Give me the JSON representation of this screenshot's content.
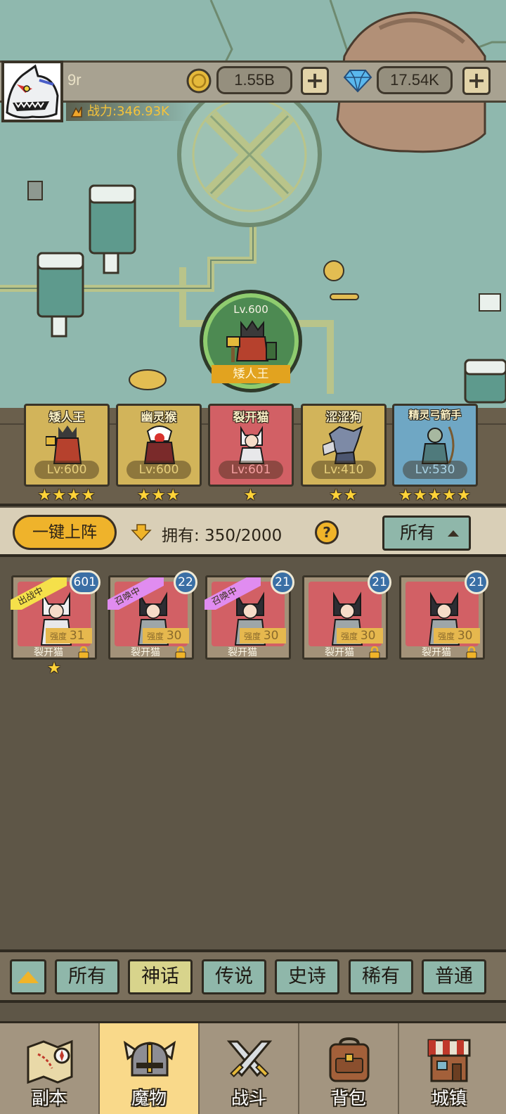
{
  "player": {
    "name": "9r",
    "power": "战力:346.93K"
  },
  "resources": {
    "gold": "1.55B",
    "gems": "17.54K",
    "plus": "+"
  },
  "featured": {
    "level": "Lv.600",
    "name": "矮人王"
  },
  "lineup": [
    {
      "name": "矮人王",
      "level": "Lv:600",
      "stars": "★★★★",
      "color": "#d2b45a"
    },
    {
      "name": "幽灵猴",
      "level": "Lv:600",
      "stars": "★★★",
      "color": "#d2b45a"
    },
    {
      "name": "裂开猫",
      "level": "Lv:601",
      "stars": "★",
      "color": "#d26065"
    },
    {
      "name": "涩涩狗",
      "level": "Lv:410",
      "stars": "★★",
      "color": "#d2b45a"
    },
    {
      "name": "精灵弓箭手",
      "level": "Lv:530",
      "stars": "★★★★★",
      "color": "#6fa7c4"
    }
  ],
  "controls": {
    "deploy": "一键上阵",
    "owned": "拥有: 350/2000",
    "help": "?",
    "filter": "所有"
  },
  "cards": [
    {
      "level": "601",
      "name": "裂开猫",
      "strength_label": "强度",
      "strength": "31",
      "ribbon": "出战中",
      "ribbon_color": "#f5e04a",
      "star": "★"
    },
    {
      "level": "22",
      "name": "裂开猫",
      "strength_label": "强度",
      "strength": "30",
      "ribbon": "召唤中",
      "ribbon_color": "#e08cf0",
      "star": ""
    },
    {
      "level": "21",
      "name": "裂开猫",
      "strength_label": "强度",
      "strength": "30",
      "ribbon": "召唤中",
      "ribbon_color": "#e08cf0",
      "star": ""
    },
    {
      "level": "21",
      "name": "裂开猫",
      "strength_label": "强度",
      "strength": "30",
      "ribbon": "",
      "ribbon_color": "",
      "star": ""
    },
    {
      "level": "21",
      "name": "裂开猫",
      "strength_label": "强度",
      "strength": "30",
      "ribbon": "",
      "ribbon_color": "",
      "star": ""
    }
  ],
  "rarity_tabs": [
    "所有",
    "神话",
    "传说",
    "史诗",
    "稀有",
    "普通"
  ],
  "active_rarity": 1,
  "nav": [
    {
      "label": "副本",
      "icon": "map-icon"
    },
    {
      "label": "魔物",
      "icon": "helmet-icon"
    },
    {
      "label": "战斗",
      "icon": "crossed-swords-icon"
    },
    {
      "label": "背包",
      "icon": "backpack-icon"
    },
    {
      "label": "城镇",
      "icon": "house-icon"
    }
  ],
  "active_nav": 1
}
